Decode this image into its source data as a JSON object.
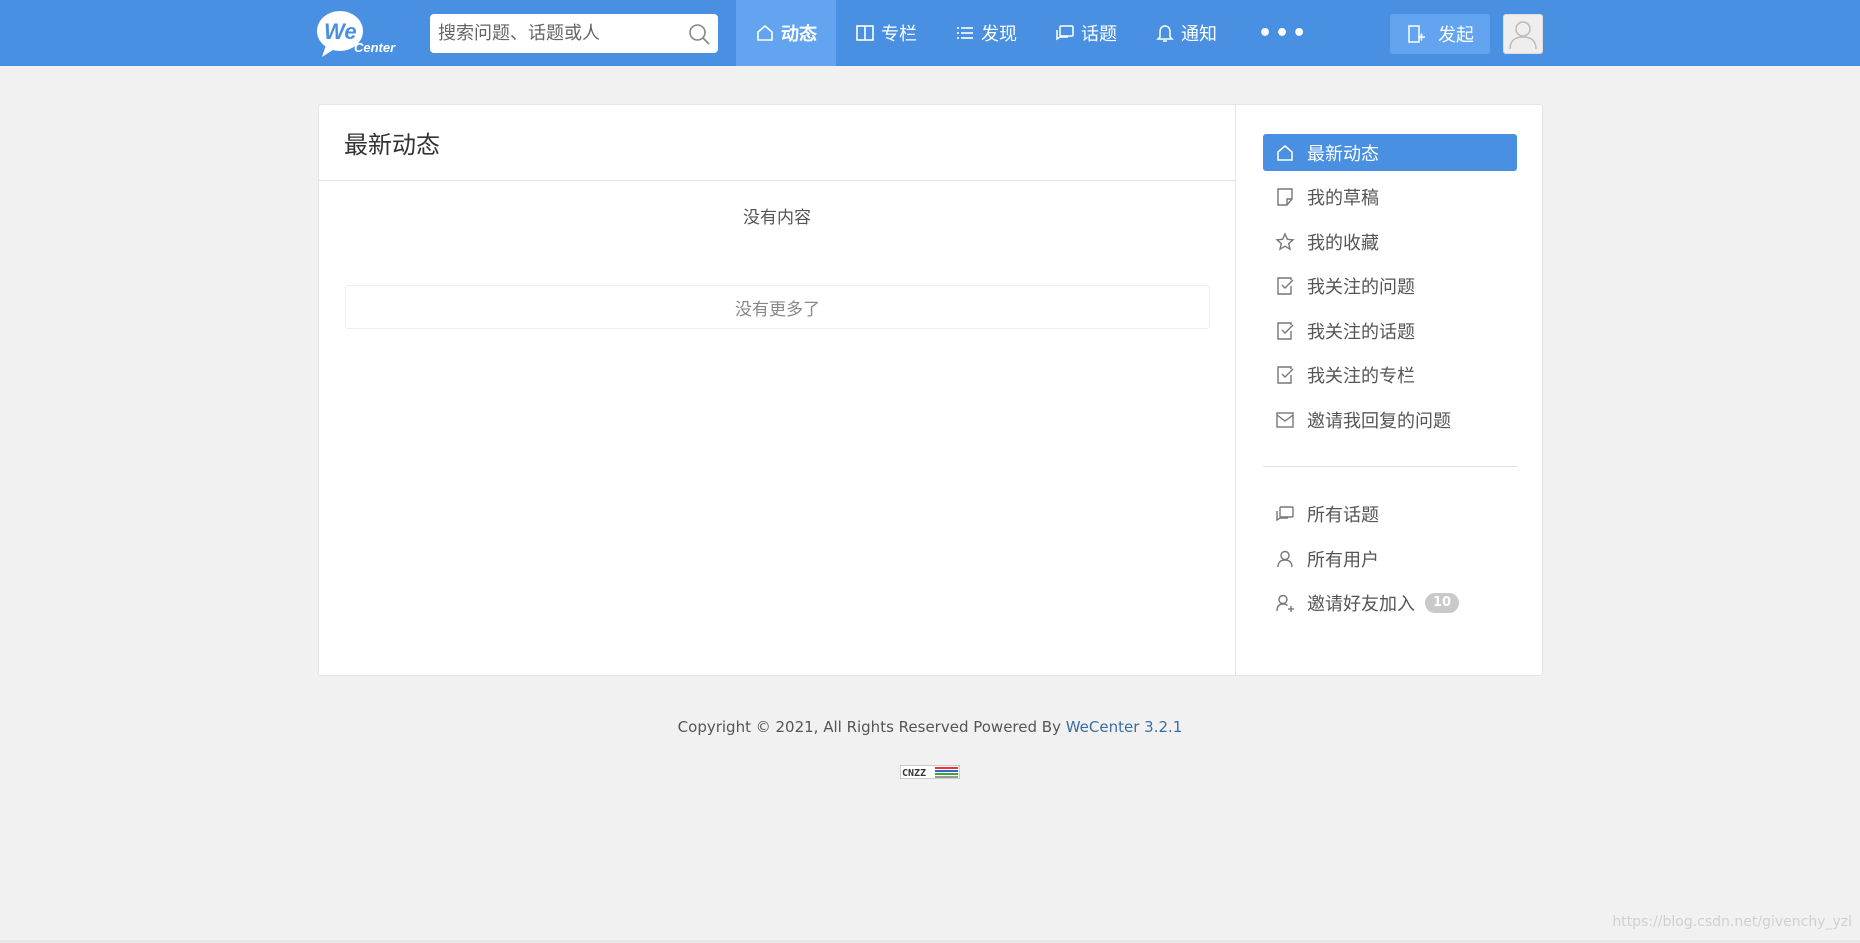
{
  "header": {
    "logo_text_we": "We",
    "logo_text_center": "Center",
    "search_placeholder": "搜索问题、话题或人",
    "nav": [
      {
        "label": "动态",
        "icon": "home-icon",
        "active": true
      },
      {
        "label": "专栏",
        "icon": "column-icon",
        "active": false
      },
      {
        "label": "发现",
        "icon": "list-icon",
        "active": false
      },
      {
        "label": "话题",
        "icon": "chat-icon",
        "active": false
      },
      {
        "label": "通知",
        "icon": "bell-icon",
        "active": false
      }
    ],
    "more_label": "•••",
    "publish_label": "发起"
  },
  "main": {
    "title": "最新动态",
    "empty_text": "没有内容",
    "no_more_text": "没有更多了"
  },
  "sidebar": {
    "items": [
      {
        "label": "最新动态",
        "icon": "home-icon",
        "active": true
      },
      {
        "label": "我的草稿",
        "icon": "draft-icon",
        "active": false
      },
      {
        "label": "我的收藏",
        "icon": "star-icon",
        "active": false
      },
      {
        "label": "我关注的问题",
        "icon": "check-doc-icon",
        "active": false
      },
      {
        "label": "我关注的话题",
        "icon": "check-doc-icon",
        "active": false
      },
      {
        "label": "我关注的专栏",
        "icon": "check-doc-icon",
        "active": false
      },
      {
        "label": "邀请我回复的问题",
        "icon": "mail-icon",
        "active": false
      }
    ],
    "items2": [
      {
        "label": "所有话题",
        "icon": "chat-icon"
      },
      {
        "label": "所有用户",
        "icon": "user-icon"
      },
      {
        "label": "邀请好友加入",
        "icon": "add-user-icon",
        "badge": "10"
      }
    ]
  },
  "footer": {
    "copyright": "Copyright © 2021, All Rights Reserved Powered By ",
    "link_text": "WeCenter 3.2.1",
    "cnzz_text": "CNZZ"
  },
  "watermark": "https://blog.csdn.net/givenchy_yzl",
  "colors": {
    "header_bg": "#4a90e2",
    "active_nav_bg": "#62a4ef",
    "sidebar_active_bg": "#4a90e2"
  }
}
